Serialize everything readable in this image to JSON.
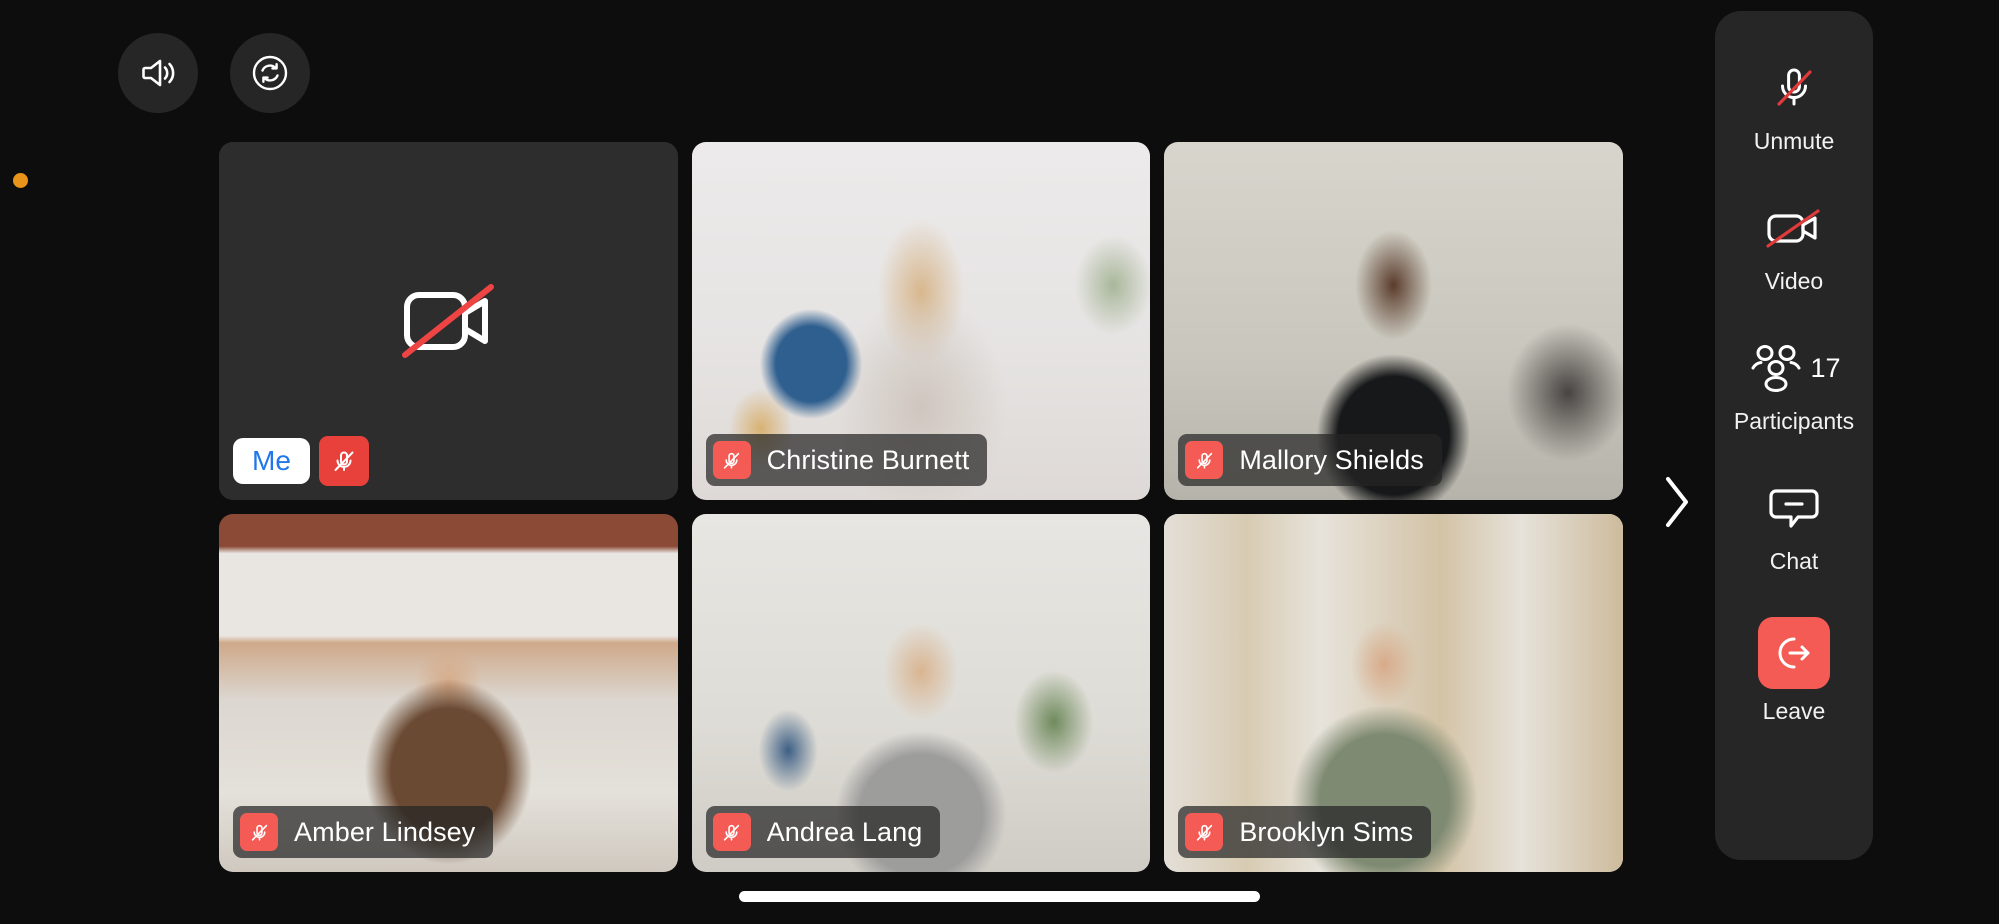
{
  "app": {
    "background_color": "#0d0d0d",
    "accent_red": "#f55b55",
    "self_label_color": "#2176e8",
    "status_dot_color": "#e8941a"
  },
  "top_controls": [
    {
      "name": "speaker",
      "icon": "speaker-icon",
      "label": "Speaker"
    },
    {
      "name": "flip-camera",
      "icon": "flip-camera-icon",
      "label": "Flip camera"
    }
  ],
  "status_indicator": {
    "icon": "recording-dot-icon",
    "color": "#e8941a"
  },
  "grid": {
    "columns": 3,
    "rows": 2,
    "tiles": [
      {
        "name": "Me",
        "is_self": true,
        "video_on": false,
        "muted": true,
        "video_off_icon": "video-off-icon",
        "mic_icon": "mic-muted-icon"
      },
      {
        "name": "Christine Burnett",
        "is_self": false,
        "video_on": true,
        "muted": true,
        "mic_icon": "mic-muted-icon"
      },
      {
        "name": "Mallory Shields",
        "is_self": false,
        "video_on": true,
        "muted": true,
        "mic_icon": "mic-muted-icon"
      },
      {
        "name": "Amber Lindsey",
        "is_self": false,
        "video_on": true,
        "muted": true,
        "mic_icon": "mic-muted-icon"
      },
      {
        "name": "Andrea Lang",
        "is_self": false,
        "video_on": true,
        "muted": true,
        "mic_icon": "mic-muted-icon"
      },
      {
        "name": "Brooklyn Sims",
        "is_self": false,
        "video_on": true,
        "muted": true,
        "mic_icon": "mic-muted-icon"
      }
    ]
  },
  "pagination": {
    "next_icon": "chevron-right-icon"
  },
  "sidebar": {
    "items": [
      {
        "label": "Unmute",
        "icon": "mic-muted-icon",
        "badge": ""
      },
      {
        "label": "Video",
        "icon": "video-off-icon",
        "badge": ""
      },
      {
        "label": "Participants",
        "icon": "participants-icon",
        "badge": "17"
      },
      {
        "label": "Chat",
        "icon": "chat-icon",
        "badge": ""
      },
      {
        "label": "Leave",
        "icon": "leave-icon",
        "badge": ""
      }
    ]
  },
  "home_indicator": {
    "visible": true
  }
}
